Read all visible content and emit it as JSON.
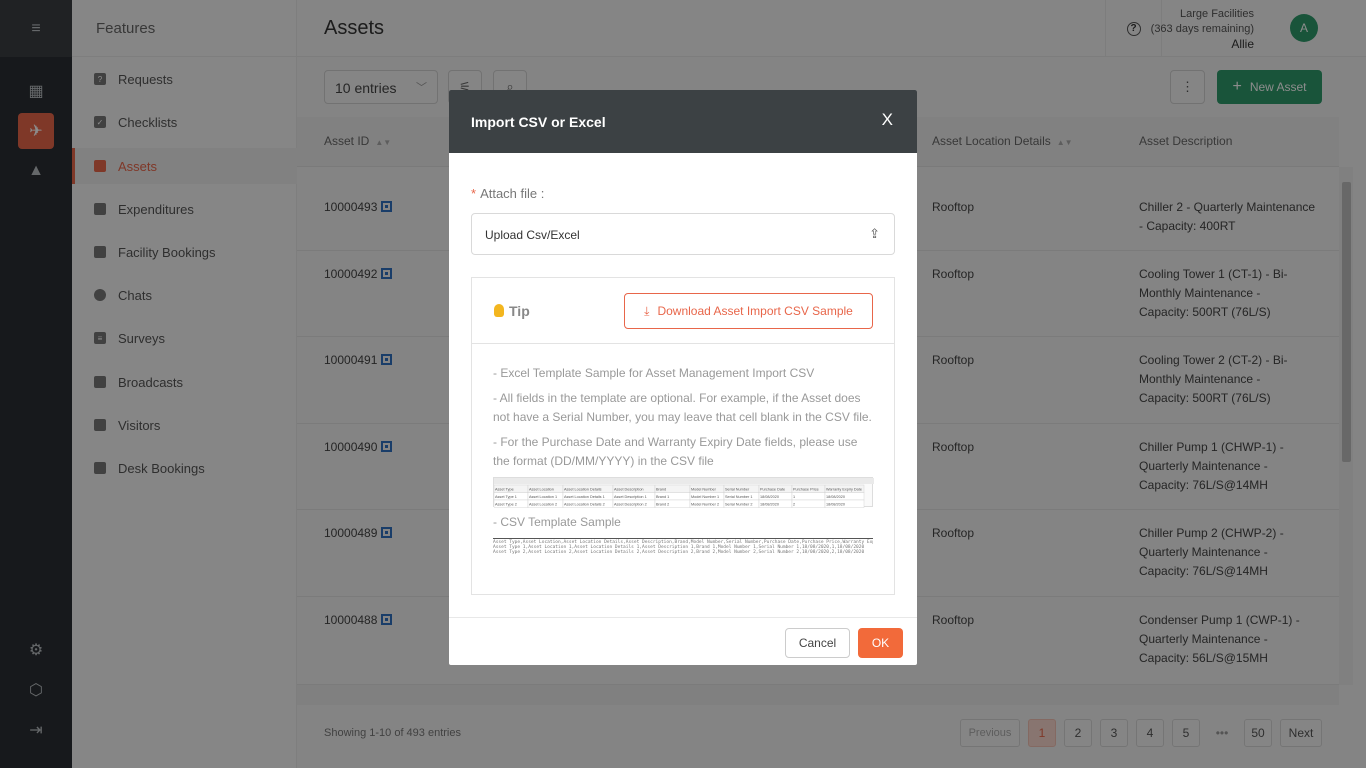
{
  "sidebar": {
    "features_title": "Features",
    "items": [
      {
        "label": "Requests",
        "icon": "request-icon"
      },
      {
        "label": "Checklists",
        "icon": "checklist-icon"
      },
      {
        "label": "Assets",
        "icon": "asset-icon"
      },
      {
        "label": "Expenditures",
        "icon": "wallet-icon"
      },
      {
        "label": "Facility Bookings",
        "icon": "calendar-icon"
      },
      {
        "label": "Chats",
        "icon": "chat-icon"
      },
      {
        "label": "Surveys",
        "icon": "survey-icon"
      },
      {
        "label": "Broadcasts",
        "icon": "megaphone-icon"
      },
      {
        "label": "Visitors",
        "icon": "visitor-icon"
      },
      {
        "label": "Desk Bookings",
        "icon": "desk-icon"
      }
    ],
    "active_item": "Assets"
  },
  "header": {
    "title": "Assets",
    "plan": "Large Facilities",
    "days_remaining": "(363 days remaining)",
    "user": "Allie",
    "avatar_initial": "A"
  },
  "toolbar": {
    "entries_select": "10 entries",
    "more_label": "⋮",
    "new_asset_label": "New Asset"
  },
  "table": {
    "columns": [
      "Asset ID",
      "Asset Location Details",
      "Asset Description"
    ],
    "rows": [
      {
        "id": "10000493",
        "location": "Rooftop",
        "description": "Chiller 2 - Quarterly Maintenance - Capacity: 400RT"
      },
      {
        "id": "10000492",
        "location": "Rooftop",
        "description": "Cooling Tower 1 (CT-1) - Bi-Monthly Maintenance - Capacity: 500RT (76L/S)"
      },
      {
        "id": "10000491",
        "location": "Rooftop",
        "description": "Cooling Tower 2 (CT-2) - Bi-Monthly Maintenance - Capacity: 500RT (76L/S)"
      },
      {
        "id": "10000490",
        "location": "Rooftop",
        "description": "Chiller Pump 1 (CHWP-1) - Quarterly Maintenance - Capacity: 76L/S@14MH"
      },
      {
        "id": "10000489",
        "location": "Rooftop",
        "description": "Chiller Pump 2 (CHWP-2) - Quarterly Maintenance - Capacity: 76L/S@14MH"
      },
      {
        "id": "10000488",
        "location": "Rooftop",
        "description": "Condenser Pump 1 (CWP-1) - Quarterly Maintenance - Capacity: 56L/S@15MH"
      }
    ]
  },
  "pagination": {
    "info": "Showing 1-10 of 493 entries",
    "previous": "Previous",
    "pages": [
      "1",
      "2",
      "3",
      "4",
      "5"
    ],
    "ellipsis": "•••",
    "last": "50",
    "next": "Next",
    "current": "1"
  },
  "modal": {
    "title": "Import CSV or Excel",
    "close": "X",
    "attach_label": "Attach file :",
    "upload_placeholder": "Upload Csv/Excel",
    "tip_label": "Tip",
    "download_button": "Download Asset Import CSV Sample",
    "tips": [
      "- Excel Template Sample for Asset Management Import CSV",
      "- All fields in the template are optional. For example, if the Asset does not have a Serial Number, you may leave that cell blank in the CSV file.",
      "- For the Purchase Date and Warranty Expiry Date fields, please use the format (DD/MM/YYYY) in the CSV file"
    ],
    "csv_sample_title": "- CSV Template Sample",
    "csv_sample_lines": [
      "Asset Type,Asset Location,Asset Location Details,Asset Description,Brand,Model Number,Serial Number,Purchase Date,Purchase Price,Warranty Expiry Date",
      "Asset Type 1,Asset Location 1,Asset Location Details 1,Asset Description 1,Brand 1,Model Number 1,Serial Number 1,18/08/2020,1,18/08/2020",
      "Asset Type 2,Asset Location 2,Asset Location Details 2,Asset Description 2,Brand 2,Model Number 2,Serial Number 2,18/08/2020,2,18/08/2020"
    ],
    "excel_sample": {
      "headers": [
        "Asset Type",
        "Asset Location",
        "Asset Location Details",
        "Asset Description",
        "Brand",
        "Model Number",
        "Serial Number",
        "Purchase Date",
        "Purchase Price",
        "Warranty Expiry Date"
      ],
      "rows": [
        [
          "Asset Type 1",
          "Asset Location 1",
          "Asset Location Details 1",
          "Asset Description 1",
          "Brand 1",
          "Model Number 1",
          "Serial Number 1",
          "18/08/2020",
          "1",
          "18/08/2020"
        ],
        [
          "Asset Type 2",
          "Asset Location 2",
          "Asset Location Details 2",
          "Asset Description 2",
          "Brand 2",
          "Model Number 2",
          "Serial Number 2",
          "18/08/2020",
          "2",
          "18/08/2020"
        ]
      ]
    },
    "cancel": "Cancel",
    "ok": "OK"
  },
  "colors": {
    "accent": "#e8664a",
    "primary_green": "#2e9a6a",
    "ok_button": "#f26a3a",
    "modal_header": "#3c4144"
  }
}
